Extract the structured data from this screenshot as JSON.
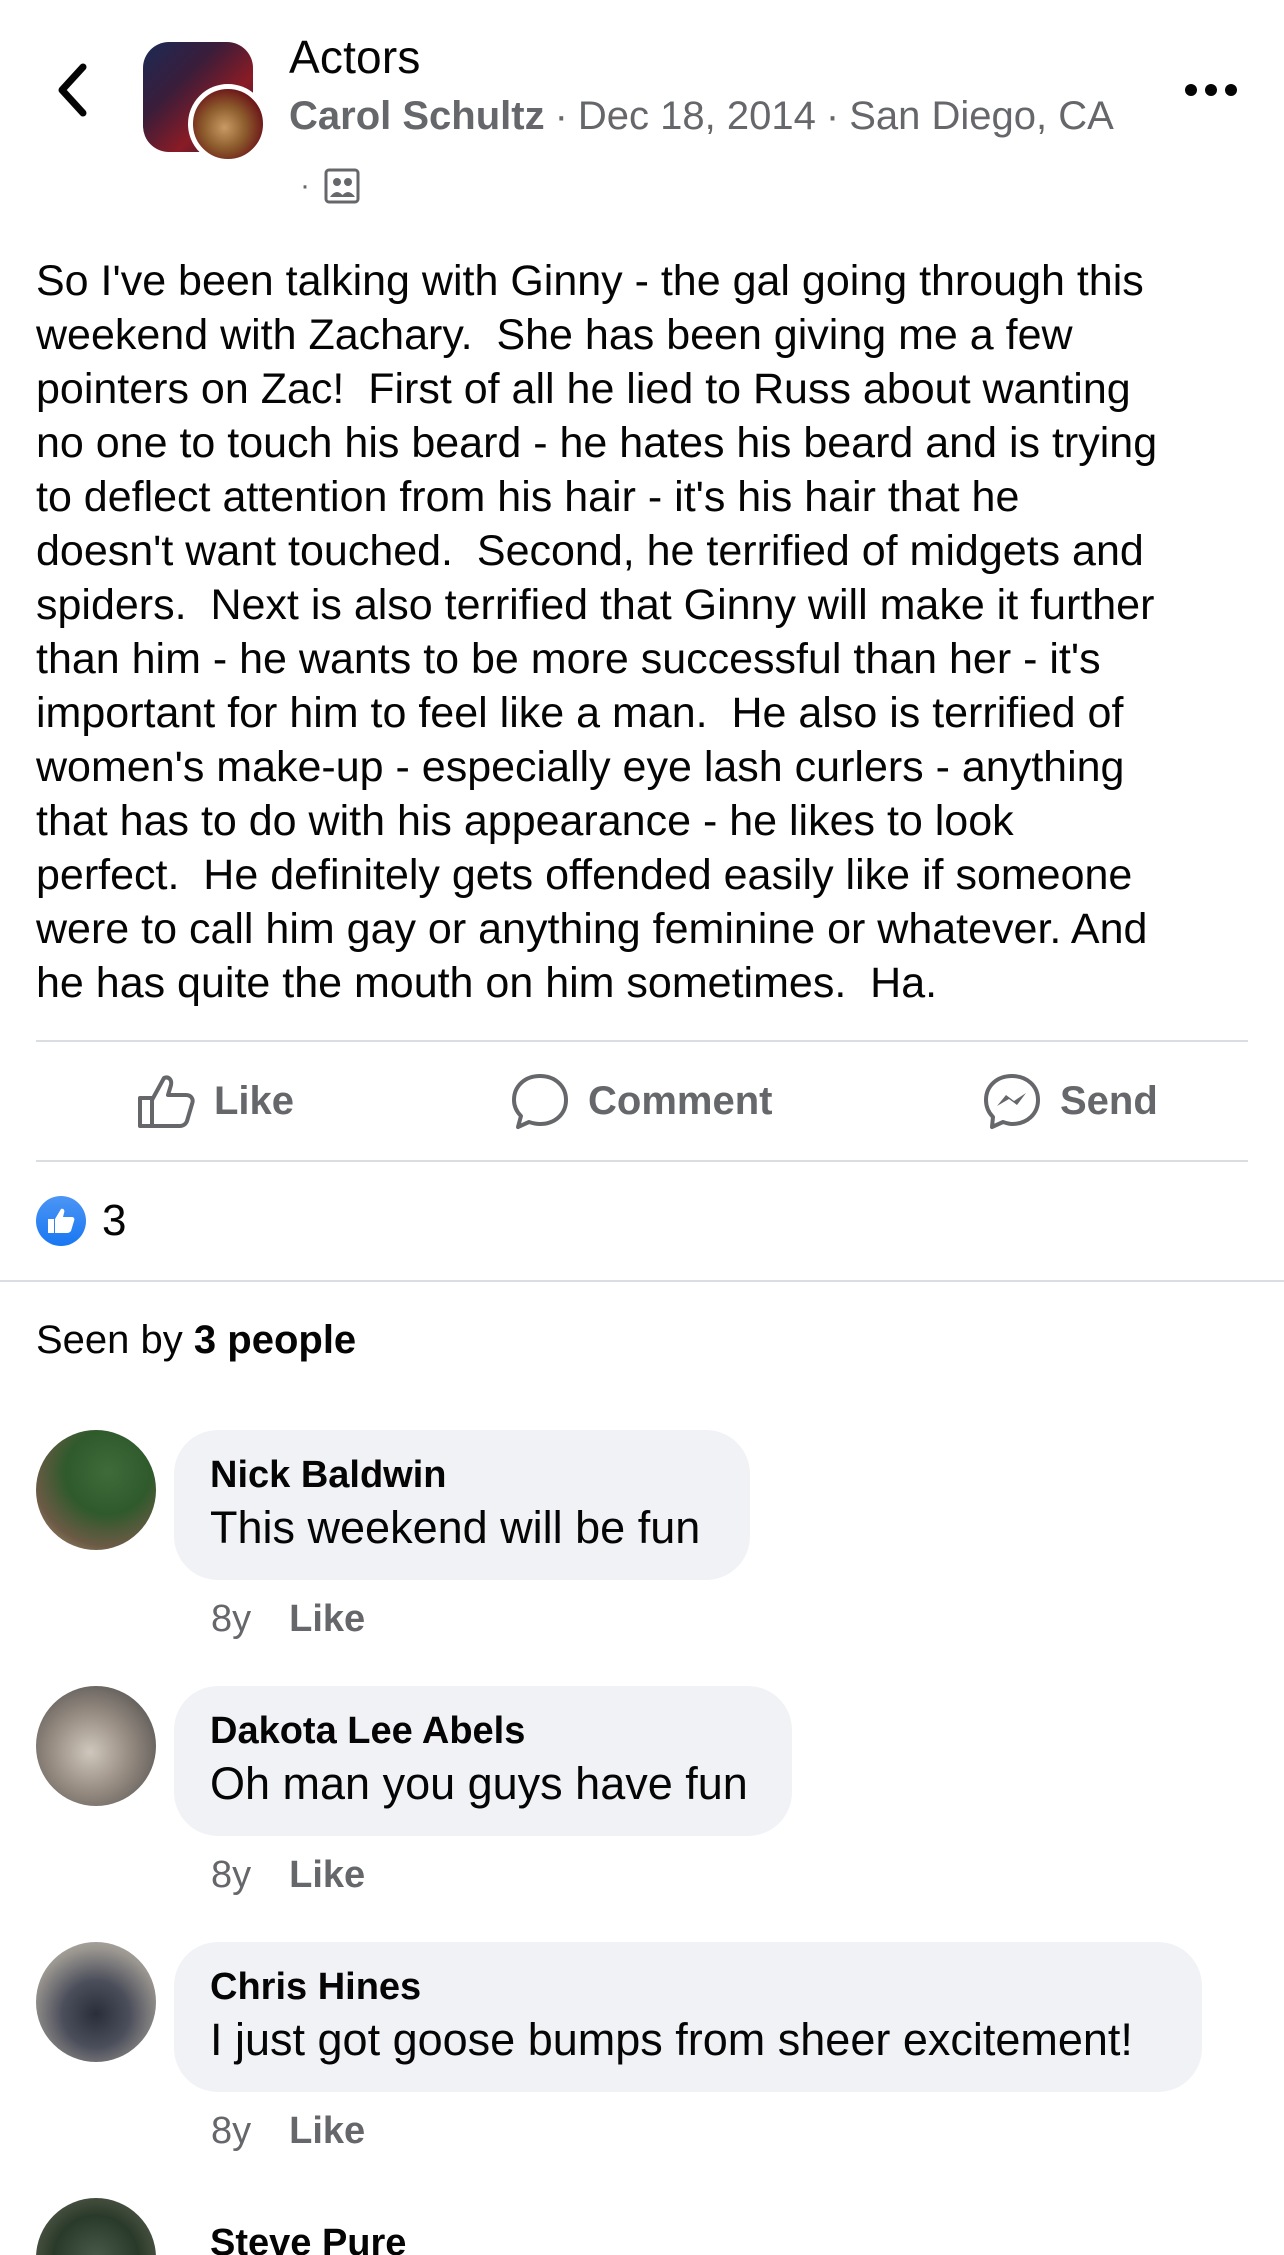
{
  "header": {
    "group_name": "Actors",
    "author": "Carol Schultz",
    "separator": "·",
    "date": "Dec 18, 2014",
    "location": "San Diego, CA",
    "icons": {
      "back": "chevron-left-icon",
      "more": "more-horizontal-icon",
      "audience": "group-members-icon"
    }
  },
  "post": {
    "body": "So I've been talking with Ginny - the gal going through this\nweekend with Zachary.  She has been giving me a few\npointers on Zac!  First of all he lied to Russ about wanting\nno one to touch his beard - he hates his beard and is trying\nto deflect attention from his hair - it's his hair that he\ndoesn't want touched.  Second, he terrified of midgets and\nspiders.  Next is also terrified that Ginny will make it further\nthan him - he wants to be more successful than her - it's\nimportant for him to feel like a man.  He also is terrified of\nwomen's make-up - especially eye lash curlers - anything\nthat has to do with his appearance - he likes to look\nperfect.  He definitely gets offended easily like if someone\nwere to call him gay or anything feminine or whatever. And\nhe has quite the mouth on him sometimes.  Ha."
  },
  "actions": {
    "like_label": "Like",
    "comment_label": "Comment",
    "send_label": "Send"
  },
  "reactions": {
    "count": "3",
    "type": "like"
  },
  "seen": {
    "prefix": "Seen by",
    "people": "3 people"
  },
  "comments": [
    {
      "name": "Nick Baldwin",
      "text": "This weekend will be fun",
      "time": "8y",
      "like_label": "Like"
    },
    {
      "name": "Dakota Lee Abels",
      "text": "Oh man you guys have fun",
      "time": "8y",
      "like_label": "Like"
    },
    {
      "name": "Chris Hines",
      "text": "I just got goose bumps from sheer excitement!",
      "time": "8y",
      "like_label": "Like"
    },
    {
      "name": "Steve Pure"
    }
  ],
  "colors": {
    "text": "#050505",
    "secondary_text": "#65676b",
    "bubble": "#f0f2f5",
    "divider": "#dadde1",
    "like_blue": "#1877f2"
  }
}
